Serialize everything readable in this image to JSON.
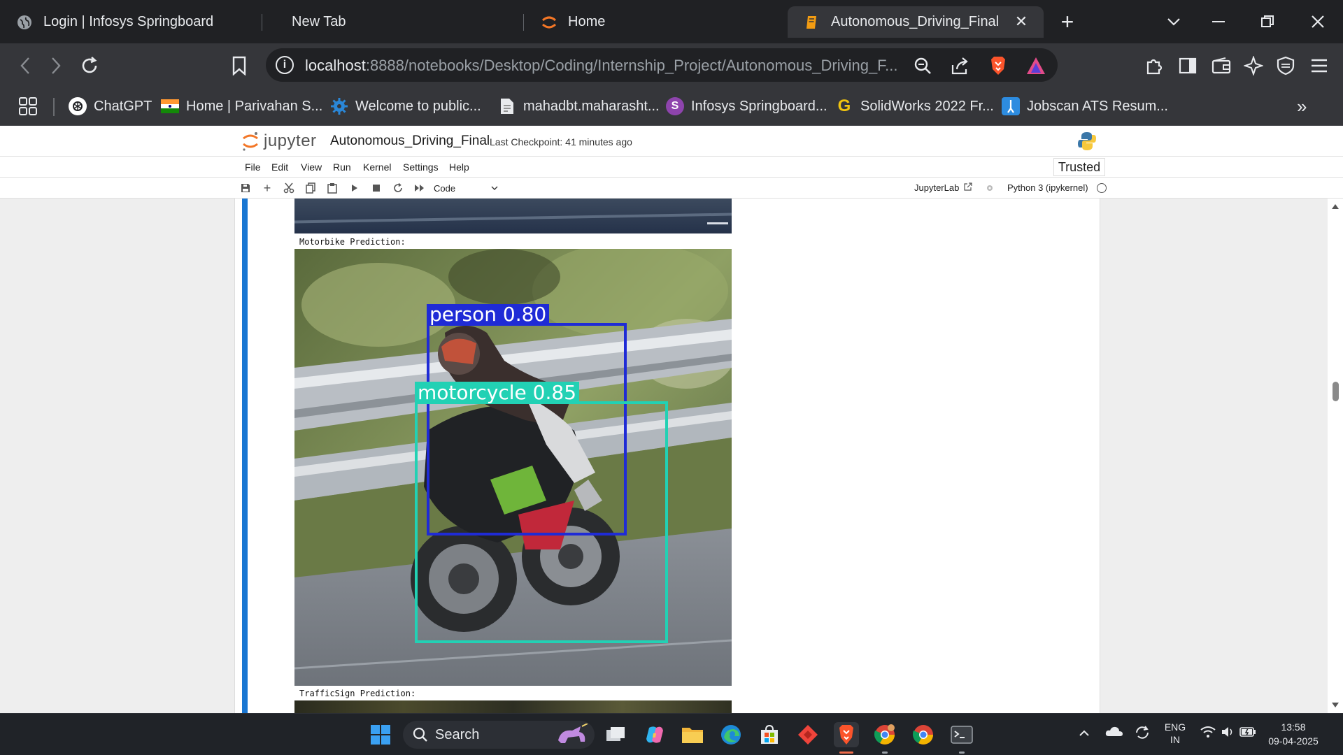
{
  "browser": {
    "tabs": [
      {
        "label": "Login | Infosys Springboard"
      },
      {
        "label": "New Tab"
      },
      {
        "label": "Home"
      },
      {
        "label": "Autonomous_Driving_Final"
      }
    ],
    "new_tab_glyph": "+",
    "url_host": "localhost",
    "url_rest": ":8888/notebooks/Desktop/Coding/Internship_Project/Autonomous_Driving_F...",
    "bookmarks": [
      {
        "label": "ChatGPT",
        "icon": "chatgpt-icon"
      },
      {
        "label": "Home | Parivahan S...",
        "icon": "india-flag-icon"
      },
      {
        "label": "Welcome to public...",
        "icon": "gear-icon"
      },
      {
        "label": "mahadbt.maharasht...",
        "icon": "document-icon"
      },
      {
        "label": "Infosys Springboard...",
        "icon": "springboard-icon"
      },
      {
        "label": "SolidWorks 2022 Fr...",
        "icon": "g-icon"
      },
      {
        "label": "Jobscan ATS Resum...",
        "icon": "jobscan-icon"
      }
    ]
  },
  "jupyter": {
    "logo_text": "jupyter",
    "notebook_title": "Autonomous_Driving_Final",
    "checkpoint": "Last Checkpoint: 41 minutes ago",
    "menu": [
      "File",
      "Edit",
      "View",
      "Run",
      "Kernel",
      "Settings",
      "Help"
    ],
    "trusted": "Trusted",
    "cell_type": "Code",
    "jupyterlab_link": "JupyterLab",
    "kernel": "Python 3 (ipykernel)"
  },
  "output": {
    "motorbike_label": "Motorbike Prediction:",
    "detections": [
      {
        "label": "person 0.80",
        "color": "#1f2bd6"
      },
      {
        "label": "motorcycle 0.85",
        "color": "#22d1b4"
      }
    ],
    "trafficsign_label": "TrafficSign Prediction:"
  },
  "taskbar": {
    "search_label": "Search",
    "lang_top": "ENG",
    "lang_bottom": "IN",
    "time": "13:58",
    "date": "09-04-2025"
  },
  "colors": {
    "accent_blue": "#1976d2",
    "chrome_dark": "#202124",
    "chrome_mid": "#35363a"
  }
}
